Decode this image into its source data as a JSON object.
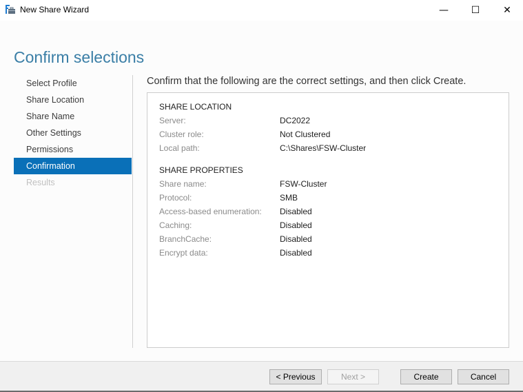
{
  "window": {
    "title": "New Share Wizard",
    "minimize_icon": "—",
    "maximize_icon": "☐",
    "close_icon": "✕"
  },
  "page": {
    "heading": "Confirm selections",
    "intro": "Confirm that the following are the correct settings, and then click Create."
  },
  "nav": {
    "items": [
      {
        "label": "Select Profile",
        "state": "normal"
      },
      {
        "label": "Share Location",
        "state": "normal"
      },
      {
        "label": "Share Name",
        "state": "normal"
      },
      {
        "label": "Other Settings",
        "state": "normal"
      },
      {
        "label": "Permissions",
        "state": "normal"
      },
      {
        "label": "Confirmation",
        "state": "active"
      },
      {
        "label": "Results",
        "state": "disabled"
      }
    ]
  },
  "summary": {
    "location": {
      "title": "SHARE LOCATION",
      "rows": [
        {
          "label": "Server:",
          "value": "DC2022"
        },
        {
          "label": "Cluster role:",
          "value": "Not Clustered"
        },
        {
          "label": "Local path:",
          "value": "C:\\Shares\\FSW-Cluster"
        }
      ]
    },
    "properties": {
      "title": "SHARE PROPERTIES",
      "rows": [
        {
          "label": "Share name:",
          "value": "FSW-Cluster"
        },
        {
          "label": "Protocol:",
          "value": "SMB"
        },
        {
          "label": "Access-based enumeration:",
          "value": "Disabled"
        },
        {
          "label": "Caching:",
          "value": "Disabled"
        },
        {
          "label": "BranchCache:",
          "value": "Disabled"
        },
        {
          "label": "Encrypt data:",
          "value": "Disabled"
        }
      ]
    }
  },
  "buttons": {
    "previous": "< Previous",
    "next": "Next >",
    "create": "Create",
    "cancel": "Cancel"
  },
  "colors": {
    "accent": "#0a70b8",
    "heading": "#3a7ea6"
  }
}
